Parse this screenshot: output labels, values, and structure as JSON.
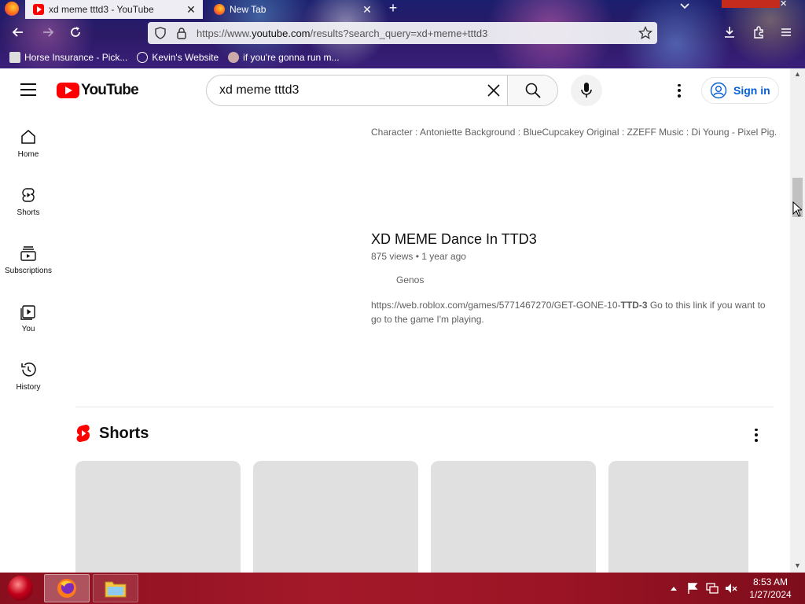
{
  "browser": {
    "tabs": [
      {
        "title": "xd meme tttd3 - YouTube",
        "active": true,
        "favicon": "youtube-icon"
      },
      {
        "title": "New Tab",
        "active": false,
        "favicon": "firefox-icon"
      }
    ],
    "url_prefix": "https://www.",
    "url_domain": "youtube.com",
    "url_rest": "/results?search_query=xd+meme+tttd3",
    "bookmarks": [
      "Horse Insurance - Pick...",
      "Kevin's Website",
      "if you're gonna run m..."
    ]
  },
  "youtube": {
    "logo_text": "YouTube",
    "search_value": "xd meme tttd3",
    "sign_in": "Sign in",
    "sidebar": [
      {
        "label": "Home",
        "icon": "home-icon"
      },
      {
        "label": "Shorts",
        "icon": "shorts-icon"
      },
      {
        "label": "Subscriptions",
        "icon": "subscriptions-icon"
      },
      {
        "label": "You",
        "icon": "you-icon"
      },
      {
        "label": "History",
        "icon": "history-icon"
      }
    ],
    "results": {
      "prev_description": "Character : Antoniette Background : BlueCupcakey Original : ZZEFF Music : Di Young - Pixel Pig.",
      "video": {
        "title": "XD MEME Dance In TTD3",
        "views": "875 views",
        "age": "1 year ago",
        "channel": "Genos",
        "desc_pre": "https://web.roblox.com/games/5771467270/GET-GONE-10-",
        "desc_bold": "TTD-3",
        "desc_post": " Go to this link if you want to go to the game I'm playing."
      }
    },
    "shorts_title": "Shorts",
    "accent": "#ff0000",
    "link_color": "#065fd4"
  },
  "taskbar": {
    "time": "8:53 AM",
    "date": "1/27/2024"
  }
}
